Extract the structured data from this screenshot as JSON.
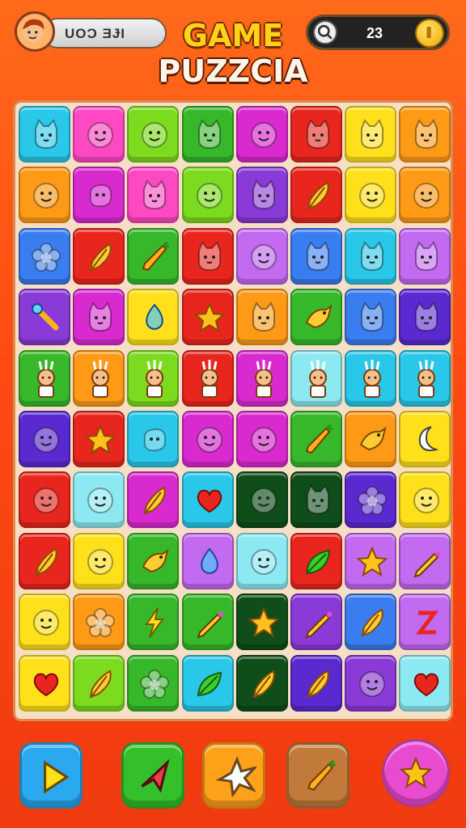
{
  "header": {
    "player_name": "UOƆ ƎɈI",
    "title_line1": "GAME",
    "title_line2": "PUZZCIA",
    "score": "23"
  },
  "colors": {
    "background": "#ff5a16",
    "board": "#f7dfc6",
    "tile_palette": {
      "cyan": "#29c7e8",
      "pink": "#ff49c2",
      "lime": "#7cdb1f",
      "green": "#36b82a",
      "magenta": "#d92ad0",
      "red": "#e8261e",
      "yellow": "#ffe01a",
      "orange": "#ff9a16",
      "purple": "#8a3ad6",
      "blue": "#3a7df0",
      "violet": "#c26af0",
      "lightcyan": "#8ce9f2",
      "darkgreen": "#0f4d1a",
      "indigo": "#5a2ad0",
      "teal": "#2ad0c8"
    }
  },
  "grid": {
    "columns": 8,
    "rows": 10,
    "tiles": [
      [
        "cyan:cat-icon",
        "pink:smiley-icon",
        "lime:smiley-icon",
        "green:cat-icon",
        "magenta:smiley-icon",
        "red:cat-icon",
        "yellow:cat-icon",
        "orange:cat-icon"
      ],
      [
        "orange:smiley-icon",
        "magenta:blob-icon",
        "pink:cat-icon",
        "lime:smiley-icon",
        "purple:cat-icon",
        "red:feather-icon",
        "yellow:smiley-icon",
        "orange:smiley-icon"
      ],
      [
        "blue:flower-icon",
        "red:feather-icon",
        "green:carrot-icon",
        "red:cat-icon",
        "violet:smiley-icon",
        "blue:cat-icon",
        "cyan:cat-icon",
        "violet:cat-icon"
      ],
      [
        "purple:wand-icon",
        "magenta:cat-icon",
        "yellow:drop-icon",
        "red:star-icon",
        "orange:cat-icon",
        "green:bird-icon",
        "blue:cat-icon",
        "indigo:cat-icon"
      ],
      [
        "green:person-icon",
        "orange:person-icon",
        "lime:person-icon",
        "red:person-icon",
        "magenta:person-icon",
        "lightcyan:person-icon",
        "cyan:person-icon",
        "cyan:person-icon"
      ],
      [
        "indigo:smiley-icon",
        "red:star-icon",
        "cyan:blob-icon",
        "magenta:smiley-icon",
        "magenta:smiley-icon",
        "green:carrot-icon",
        "orange:bird-icon",
        "yellow:moon-icon"
      ],
      [
        "red:smiley-icon",
        "lightcyan:smiley-icon",
        "magenta:feather-icon",
        "cyan:heart-icon",
        "darkgreen:smiley-icon",
        "darkgreen:cat-icon",
        "indigo:flower-icon",
        "yellow:smiley-icon"
      ],
      [
        "red:feather-icon",
        "yellow:smiley-icon",
        "green:bird-icon",
        "violet:drop-icon",
        "lightcyan:smiley-icon",
        "red:leaf-icon",
        "violet:star-icon",
        "violet:pencil-icon"
      ],
      [
        "yellow:smiley-icon",
        "orange:flower-icon",
        "green:bolt-icon",
        "green:pencil-icon",
        "darkgreen:star-icon",
        "purple:pencil-icon",
        "blue:feather-icon",
        "violet:z-icon"
      ],
      [
        "yellow:heart-icon",
        "lime:feather-icon",
        "green:flower-icon",
        "cyan:leaf-icon",
        "darkgreen:feather-icon",
        "indigo:feather-icon",
        "purple:smiley-icon",
        "lightcyan:heart-icon"
      ]
    ]
  },
  "controls": [
    {
      "name": "play-button",
      "color": "#2aa8f0",
      "icon": "play-icon"
    },
    {
      "name": "tool-button",
      "color": "#34c02a",
      "icon": "arrowhead-icon"
    },
    {
      "name": "shuffle-button",
      "color": "#ffa21a",
      "icon": "burst-icon"
    },
    {
      "name": "bonus-button",
      "color": "#c27a3a",
      "icon": "carrot-icon"
    },
    {
      "name": "star-button",
      "color": "#e84ad0",
      "icon": "star-icon"
    }
  ]
}
